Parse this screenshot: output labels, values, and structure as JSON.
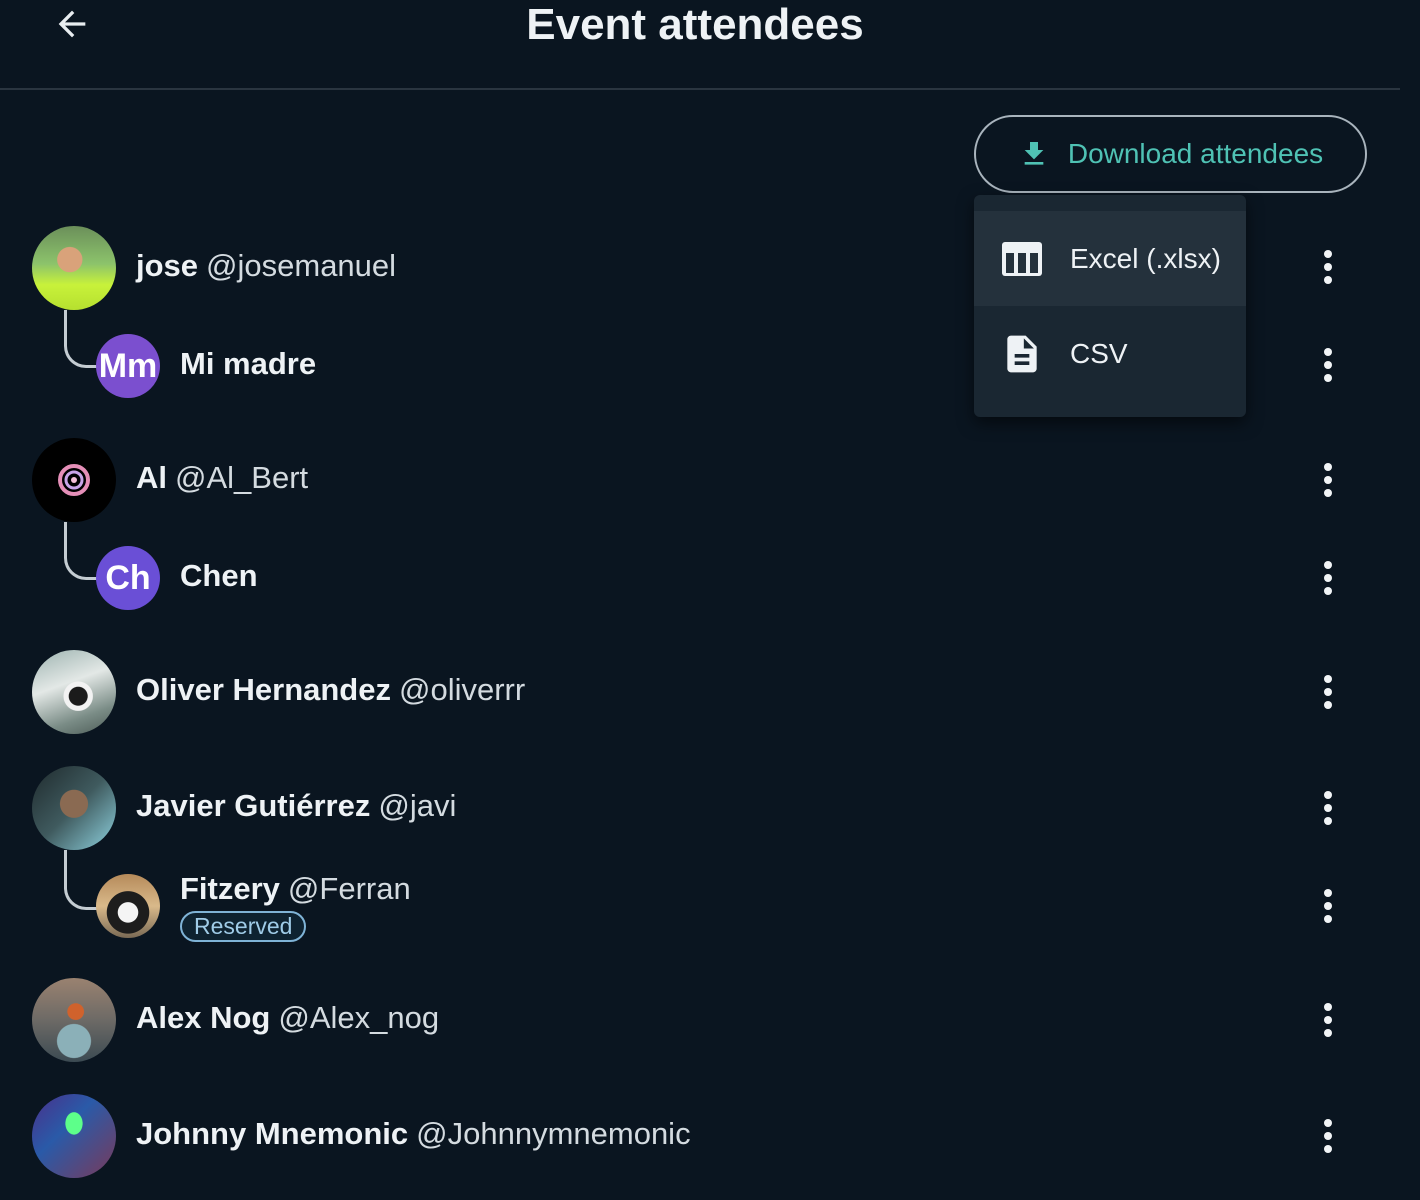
{
  "header": {
    "title": "Event attendees",
    "back_icon": "arrow-left-icon"
  },
  "download": {
    "label": "Download attendees",
    "icon": "download-icon",
    "accent": "#4fc2b4",
    "menu": [
      {
        "label": "Excel (.xlsx)",
        "icon": "table-icon"
      },
      {
        "label": "CSV",
        "icon": "file-text-icon"
      }
    ]
  },
  "attendees": [
    {
      "name": "jose",
      "handle": "@josemanuel",
      "avatar": "photo",
      "guests": [
        {
          "name": "Mi madre",
          "initials": "Mm",
          "color": "#7b4fcf"
        }
      ]
    },
    {
      "name": "Al",
      "handle": "@Al_Bert",
      "avatar": "swirl-logo",
      "guests": [
        {
          "name": "Chen",
          "initials": "Ch",
          "color": "#6a4fd6"
        }
      ]
    },
    {
      "name": "Oliver Hernandez",
      "handle": "@oliverrr",
      "avatar": "photo-puffin",
      "guests": []
    },
    {
      "name": "Javier Gutiérrez",
      "handle": "@javi",
      "avatar": "photo",
      "guests": [
        {
          "name": "Fitzery",
          "handle": "@Ferran",
          "avatar": "photo-cat",
          "badge": "Reserved"
        }
      ]
    },
    {
      "name": "Alex Nog",
      "handle": "@Alex_nog",
      "avatar": "photo",
      "guests": []
    },
    {
      "name": "Johnny Mnemonic",
      "handle": "@Johnnymnemonic",
      "avatar": "photo",
      "guests": []
    }
  ]
}
